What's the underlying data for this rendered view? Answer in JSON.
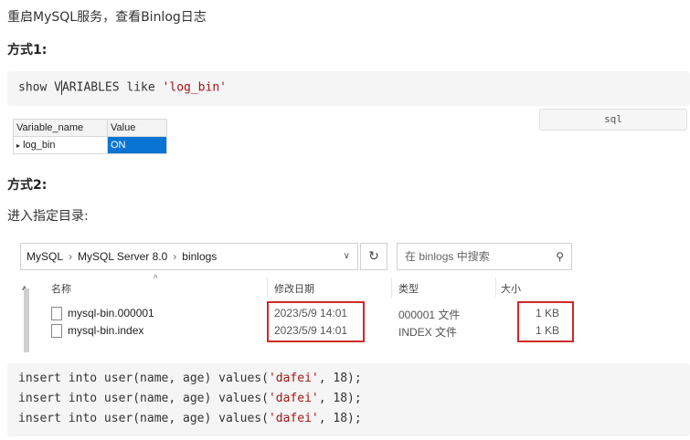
{
  "intro": "重启MySQL服务，查看Binlog日志",
  "method1": {
    "heading": "方式1:",
    "code_kw1": "show ",
    "code_cursor_pre": "V",
    "code_kw2": "ARIABLES like ",
    "code_str": "'log_bin'",
    "lang_tag": "sql"
  },
  "result_grid": {
    "columns": [
      "Variable_name",
      "Value"
    ],
    "row": {
      "marker": "▸",
      "name": "log_bin",
      "value": "ON"
    }
  },
  "method2": {
    "heading": "方式2:",
    "instruction": "进入指定目录:"
  },
  "explorer": {
    "breadcrumb": [
      "MySQL",
      "MySQL Server 8.0",
      "binlogs"
    ],
    "breadcrumb_sep": "›",
    "search_placeholder": "在 binlogs 中搜索",
    "columns": {
      "name": "名称",
      "modified": "修改日期",
      "type": "类型",
      "size": "大小"
    },
    "files": [
      {
        "name": "mysql-bin.000001",
        "modified": "2023/5/9 14:01",
        "type": "000001 文件",
        "size": "1 KB"
      },
      {
        "name": "mysql-bin.index",
        "modified": "2023/5/9 14:01",
        "type": "INDEX 文件",
        "size": "1 KB"
      }
    ]
  },
  "insert_code": {
    "kw": "insert into ",
    "mid": "user(name, age) values(",
    "str": "'dafei'",
    "tail": ", 18);",
    "line_count": 3
  },
  "colors": {
    "highlight_box": "#d12a2a",
    "selected_cell": "#0a74d4"
  }
}
